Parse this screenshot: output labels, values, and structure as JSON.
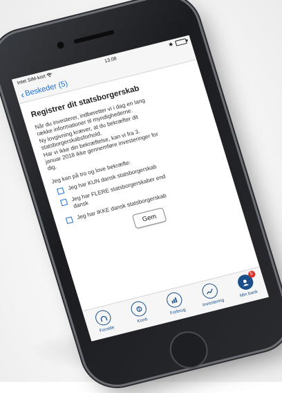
{
  "statusbar": {
    "carrier": "Intet SIM-kort",
    "wifi_icon": "wifi-icon",
    "time": "13.08",
    "bluetooth_icon": "bluetooth-icon",
    "battery_icon": "battery-icon"
  },
  "navbar": {
    "back_label": "Beskeder (5)"
  },
  "page": {
    "title": "Registrer dit statsborgerskab",
    "intro_lines": [
      "Når du investerer, indberetter vi i dag en lang",
      "række informationer til myndighederne.",
      "Ny lovgivning kræver, at du bekræfter dit",
      "statsborgerskabsforhold.",
      "Har vi ikke din bekræftelse, kan vi fra 3.",
      "januar 2018 ikke gennemføre investeringer for",
      "dig."
    ],
    "lead": "Jeg kan på tro og love bekræfte:",
    "options": [
      "Jeg har KUN dansk statsborgerskab",
      "Jeg har FLERE statsborgerskaber end dansk",
      "Jeg har IKKE dansk statsborgerskab"
    ],
    "save_label": "Gem"
  },
  "tabbar": {
    "items": [
      {
        "label": "Forside",
        "icon": "home-icon"
      },
      {
        "label": "Konti",
        "icon": "accounts-icon"
      },
      {
        "label": "Forbrug",
        "icon": "spending-icon"
      },
      {
        "label": "Investering",
        "icon": "investment-icon"
      },
      {
        "label": "Min bank",
        "icon": "profile-icon",
        "badge": "5"
      }
    ]
  },
  "colors": {
    "accent": "#1a6fd6",
    "tab": "#1a4f8a",
    "badge": "#d93025"
  }
}
